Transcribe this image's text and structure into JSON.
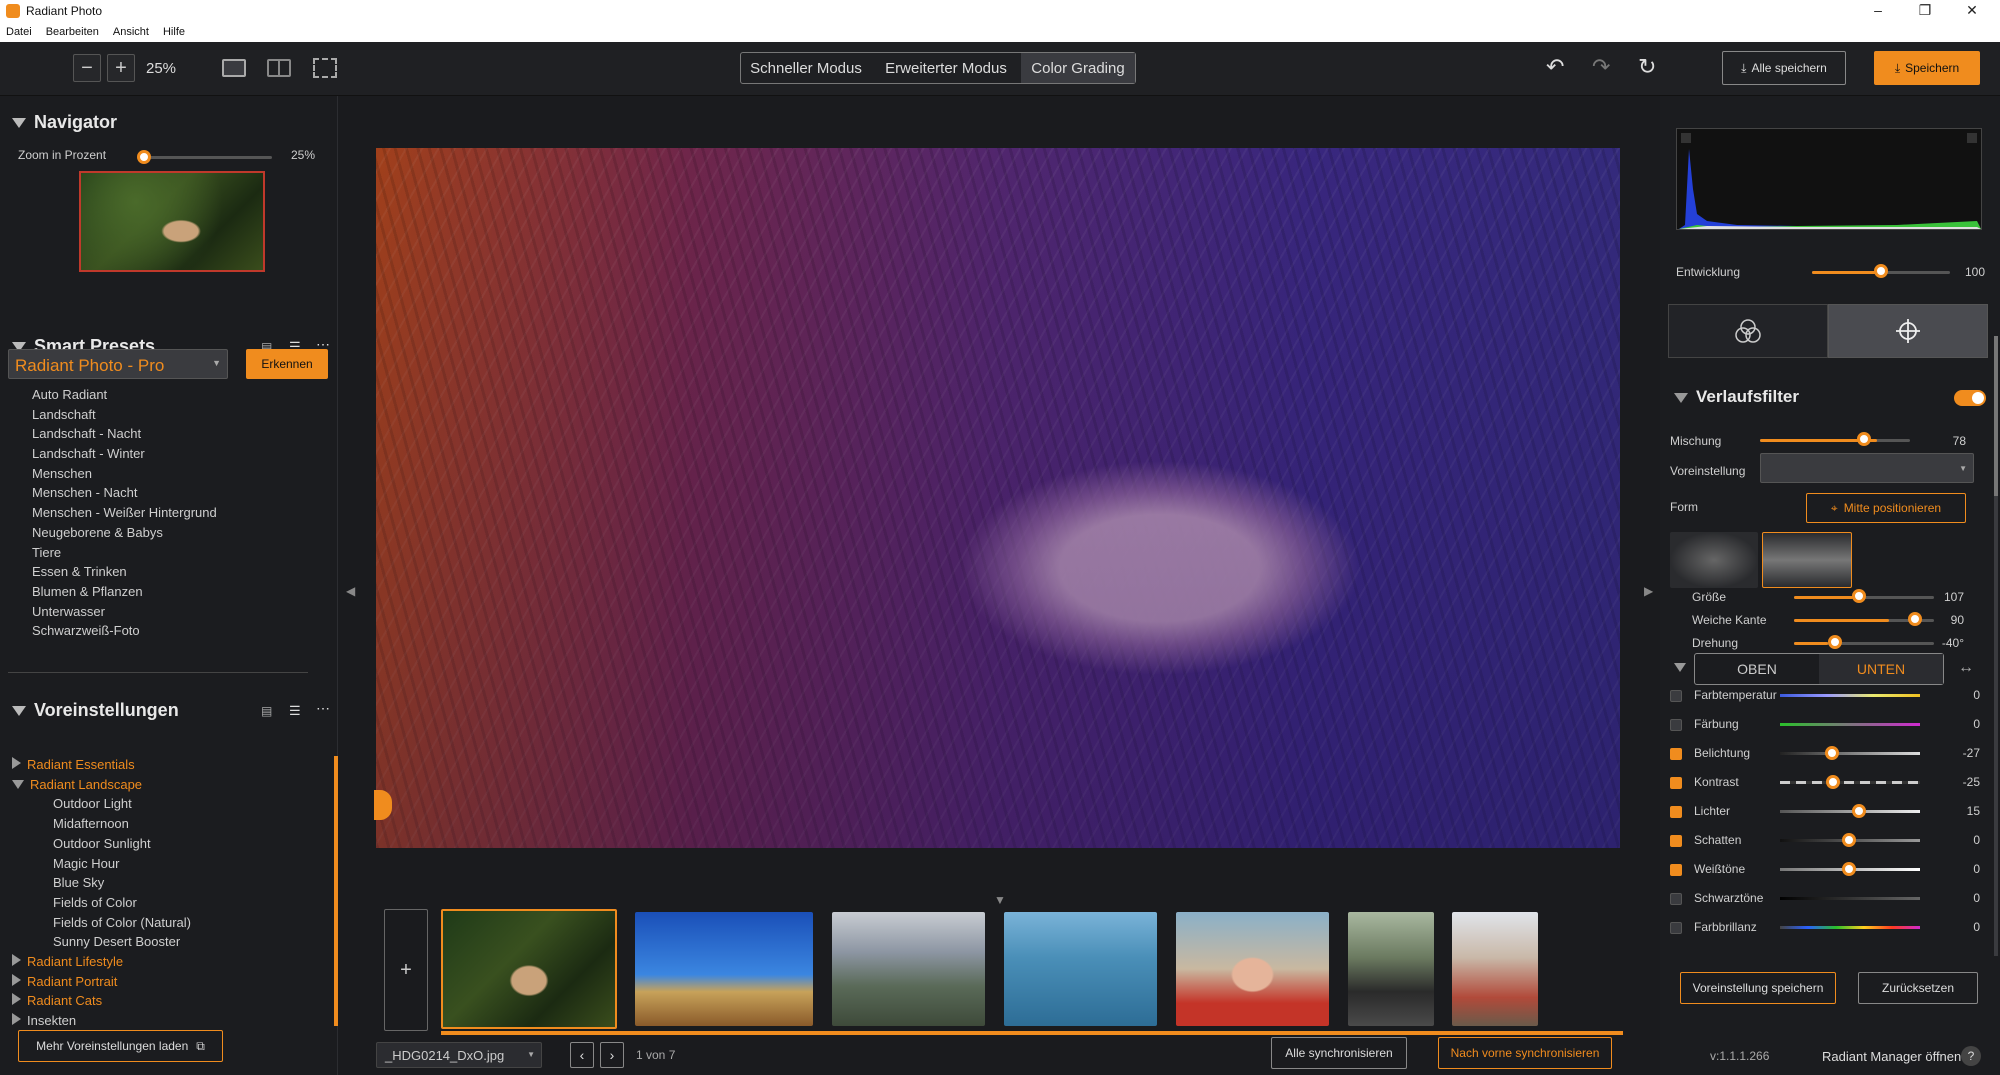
{
  "app": {
    "title": "Radiant Photo",
    "menu": [
      "Datei",
      "Bearbeiten",
      "Ansicht",
      "Hilfe"
    ]
  },
  "toolbar": {
    "zoom_value": "25%",
    "modes": [
      "Schneller Modus",
      "Erweiterter Modus",
      "Color Grading"
    ],
    "active_mode": "Color Grading",
    "save_all_label": "Alle speichern",
    "save_label": "Speichern"
  },
  "navigator": {
    "title": "Navigator",
    "zoom_label": "Zoom in Prozent",
    "zoom_value": "25%",
    "zoom_level": 0.25
  },
  "smart_presets": {
    "title": "Smart Presets",
    "selected": "Radiant Photo - Pro",
    "detect_button": "Erkennen",
    "items": [
      "Auto Radiant",
      "Landschaft",
      "Landschaft - Nacht",
      "Landschaft - Winter",
      "Menschen",
      "Menschen - Nacht",
      "Menschen - Weißer Hintergrund",
      "Neugeborene & Babys",
      "Tiere",
      "Essen & Trinken",
      "Blumen & Pflanzen",
      "Unterwasser",
      "Schwarzweiß-Foto"
    ]
  },
  "voreinstellungen": {
    "title": "Voreinstellungen",
    "groups": [
      {
        "label": "Radiant Essentials",
        "expanded": false,
        "children": []
      },
      {
        "label": "Radiant Landscape",
        "expanded": true,
        "children": [
          "Outdoor Light",
          "Midafternoon",
          "Outdoor Sunlight",
          "Magic Hour",
          "Blue Sky",
          "Fields of Color",
          "Fields of Color (Natural)",
          "Sunny Desert Booster"
        ]
      },
      {
        "label": "Radiant Lifestyle",
        "expanded": false,
        "children": []
      },
      {
        "label": "Radiant Portrait",
        "expanded": false,
        "children": []
      },
      {
        "label": "Radiant Cats",
        "expanded": false,
        "children": []
      },
      {
        "label": "Insekten",
        "expanded": false,
        "children": []
      }
    ],
    "more_button": "Mehr Voreinstellungen laden"
  },
  "filmstrip": {
    "filename": "_HDG0214_DxO.jpg",
    "page_info": "1 von 7",
    "sync_all": "Alle synchronisieren",
    "sync_forward": "Nach vorne synchronisieren"
  },
  "right": {
    "entwicklung": {
      "label": "Entwicklung",
      "value": "100"
    },
    "verlaufsfilter": {
      "title": "Verlaufsfilter",
      "enabled": true,
      "mischung": {
        "label": "Mischung",
        "value": "78"
      },
      "voreinstellung_label": "Voreinstellung",
      "form_label": "Form",
      "center_button": "Mitte positionieren",
      "groesse": {
        "label": "Größe",
        "value": "107"
      },
      "weiche_kante": {
        "label": "Weiche Kante",
        "value": "90"
      },
      "drehung": {
        "label": "Drehung",
        "value": "-40°"
      },
      "tabs": [
        "OBEN",
        "UNTEN"
      ],
      "active_tab": "UNTEN",
      "params": [
        {
          "label": "Farbtemperatur",
          "value": "0",
          "checked": false,
          "level": 0.5
        },
        {
          "label": "Färbung",
          "value": "0",
          "checked": false,
          "level": 0.5
        },
        {
          "label": "Belichtung",
          "value": "-27",
          "checked": true,
          "level": 0.37
        },
        {
          "label": "Kontrast",
          "value": "-25",
          "checked": true,
          "level": 0.38
        },
        {
          "label": "Lichter",
          "value": "15",
          "checked": true,
          "level": 0.57
        },
        {
          "label": "Schatten",
          "value": "0",
          "checked": true,
          "level": 0.5
        },
        {
          "label": "Weißtöne",
          "value": "0",
          "checked": true,
          "level": 0.5
        },
        {
          "label": "Schwarztöne",
          "value": "0",
          "checked": false,
          "level": 0.5
        },
        {
          "label": "Farbbrillanz",
          "value": "0",
          "checked": false,
          "level": 0.5
        }
      ]
    },
    "save_preset_button": "Voreinstellung speichern",
    "reset_button": "Zurücksetzen",
    "version": "v:1.1.1.266",
    "manager_link": "Radiant Manager öffnen"
  },
  "colors": {
    "accent": "#f08c1e",
    "panel": "#1b1c1f",
    "canvas": "#1a1b1e"
  }
}
